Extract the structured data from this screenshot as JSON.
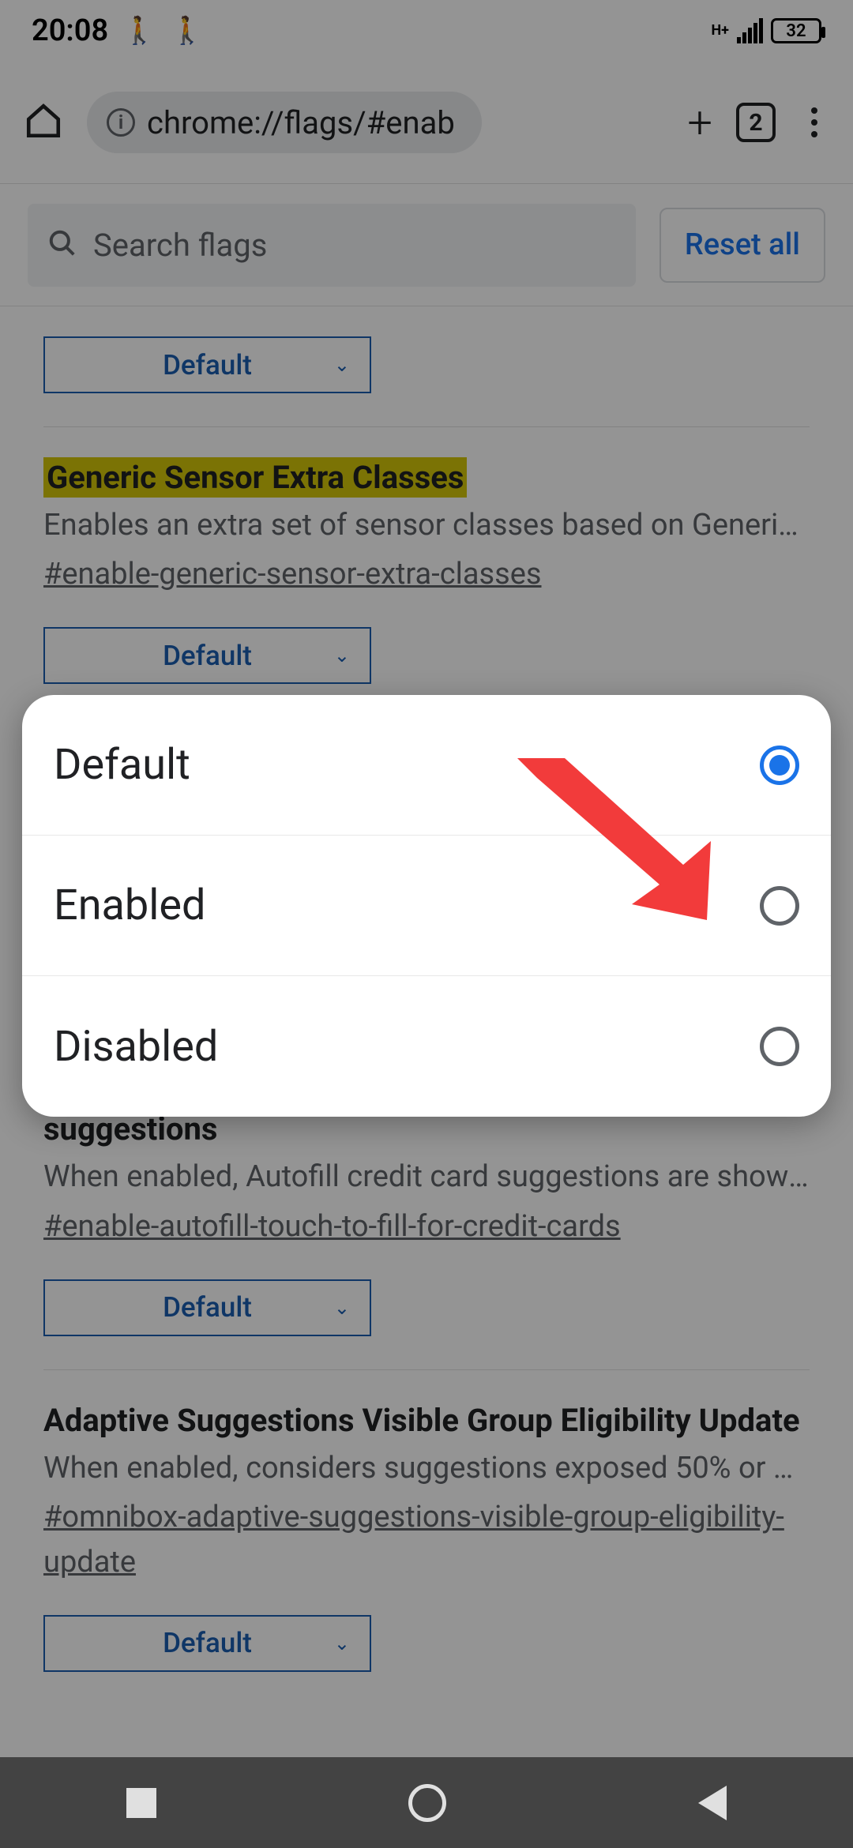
{
  "status_bar": {
    "time": "20:08",
    "network_type": "H+",
    "battery_percent": "32"
  },
  "browser": {
    "url": "chrome://flags/#enab",
    "tab_count": "2"
  },
  "search": {
    "placeholder": "Search flags",
    "reset_label": "Reset all"
  },
  "flags": [
    {
      "select_value": "Default"
    },
    {
      "title": "Generic Sensor Extra Classes",
      "highlighted": true,
      "description": "Enables an extra set of sensor classes based on Generic S…",
      "hash": "#enable-generic-sensor-extra-classes",
      "select_value": "Default"
    },
    {
      "title_suffix": "suggestions",
      "description": "When enabled, Autofill credit card suggestions are shown …",
      "hash": "#enable-autofill-touch-to-fill-for-credit-cards",
      "select_value": "Default"
    },
    {
      "title": "Adaptive Suggestions Visible Group Eligibility Update",
      "description": "When enabled, considers suggestions exposed 50% or mor…",
      "hash": "#omnibox-adaptive-suggestions-visible-group-eligibility-update",
      "select_value": "Default"
    }
  ],
  "dialog": {
    "options": [
      {
        "label": "Default",
        "selected": true
      },
      {
        "label": "Enabled",
        "selected": false
      },
      {
        "label": "Disabled",
        "selected": false
      }
    ]
  },
  "annotation": {
    "arrow_color": "#f23b3b"
  }
}
